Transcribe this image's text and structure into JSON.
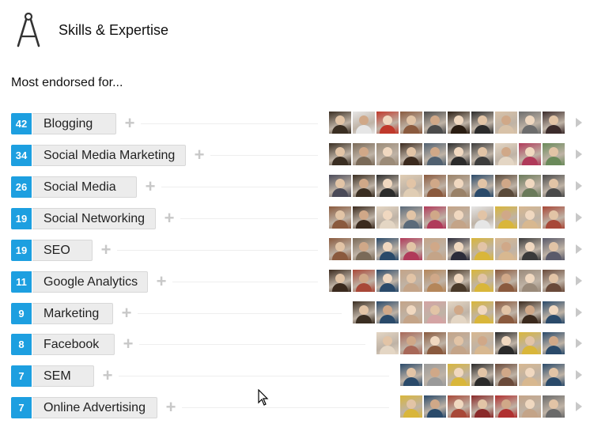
{
  "section": {
    "title": "Skills & Expertise",
    "icon": "compass-icon"
  },
  "subtitle": "Most endorsed for...",
  "colors": {
    "count_badge": "#1d9fe0",
    "pill_bg": "#ececec",
    "plus": "#c8c8c8"
  },
  "skills": [
    {
      "count": "42",
      "label": "Blogging",
      "avatar_count": 10,
      "avatars": [
        "#3a2e22",
        "#e6e6e6",
        "#c0392b",
        "#8a5a3e",
        "#4b4b4b",
        "#2a1d12",
        "#2b2b2b",
        "#d8c2a8",
        "#6c6c6c",
        "#3b2b2b"
      ]
    },
    {
      "count": "34",
      "label": "Social Media Marketing",
      "avatar_count": 10,
      "avatars": [
        "#3a2e22",
        "#7a6a58",
        "#9b8b78",
        "#3b2a1e",
        "#506070",
        "#2b2b2b",
        "#3c3c3c",
        "#e4d6c4",
        "#b03a5a",
        "#6a8a5a"
      ]
    },
    {
      "count": "26",
      "label": "Social Media",
      "avatar_count": 10,
      "avatars": [
        "#4a4a58",
        "#3a2e22",
        "#2c2c2c",
        "#e0cdb4",
        "#8a5a3e",
        "#9a8268",
        "#2a4a6a",
        "#5a4a3a",
        "#6a7a5a",
        "#4a4a4a"
      ]
    },
    {
      "count": "19",
      "label": "Social Networking",
      "avatar_count": 10,
      "avatars": [
        "#8a5a3e",
        "#3b2a1e",
        "#e4d6c4",
        "#5a6a7a",
        "#b03a5a",
        "#c4a488",
        "#e6e6e6",
        "#d9b63a",
        "#d8b890",
        "#a84838"
      ]
    },
    {
      "count": "19",
      "label": "SEO",
      "avatar_count": 10,
      "avatars": [
        "#8a5a3e",
        "#7a6a58",
        "#2a4a6a",
        "#b03a5a",
        "#c4a488",
        "#2c2c3a",
        "#d9b63a",
        "#d8b890",
        "#3a3a3a",
        "#5a5a6a"
      ]
    },
    {
      "count": "11",
      "label": "Google Analytics",
      "avatar_count": 10,
      "avatars": [
        "#3b2a1e",
        "#a84838",
        "#2a4a6a",
        "#c4a488",
        "#b4865a",
        "#4a3a2a",
        "#d9b63a",
        "#8a5a3e",
        "#9a8a7a",
        "#6a4a3a"
      ]
    },
    {
      "count": "9",
      "label": "Marketing",
      "avatar_count": 9,
      "avatars": [
        "#3a2e22",
        "#2a4a6a",
        "#c4a488",
        "#d4a4a4",
        "#e4d6c4",
        "#d9b63a",
        "#8a5a3e",
        "#3b2a1e",
        "#2a4a6a"
      ]
    },
    {
      "count": "8",
      "label": "Facebook",
      "avatar_count": 8,
      "avatars": [
        "#e4d6c4",
        "#a86858",
        "#8a5a3e",
        "#c4a488",
        "#d8b890",
        "#2a2a2a",
        "#d9b63a",
        "#2a4a6a"
      ]
    },
    {
      "count": "7",
      "label": "SEM",
      "avatar_count": 7,
      "avatars": [
        "#2a4a6a",
        "#9a9a9a",
        "#d9b63a",
        "#2a2a2a",
        "#6a4a3a",
        "#d8b890",
        "#2a4a6a"
      ]
    },
    {
      "count": "7",
      "label": "Online Advertising",
      "avatar_count": 7,
      "avatars": [
        "#d9b63a",
        "#2a4a6a",
        "#a84838",
        "#8a2a2a",
        "#b03030",
        "#c4a488",
        "#6a6a6a"
      ]
    }
  ]
}
